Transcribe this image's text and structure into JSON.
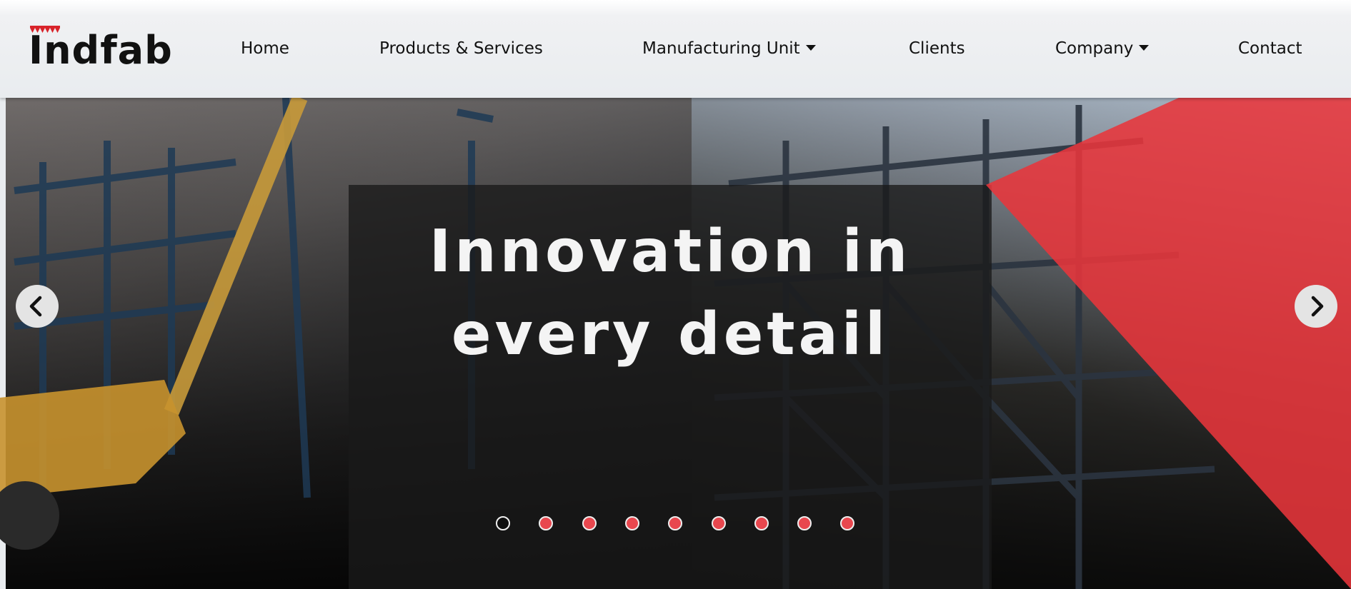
{
  "brand": {
    "logo_text": "Indfab",
    "accent_color": "#e8353b"
  },
  "nav": {
    "items": [
      {
        "label": "Home",
        "has_dropdown": false
      },
      {
        "label": "Products & Services",
        "has_dropdown": false
      },
      {
        "label": "Manufacturing Unit",
        "has_dropdown": true
      },
      {
        "label": "Clients",
        "has_dropdown": false
      },
      {
        "label": "Company",
        "has_dropdown": true
      },
      {
        "label": "Contact",
        "has_dropdown": false
      }
    ]
  },
  "hero": {
    "caption_line1": "Innovation in",
    "caption_line2": "every detail",
    "prev_icon": "chevron-left-icon",
    "next_icon": "chevron-right-icon",
    "slide_count": 9,
    "active_slide": 1
  }
}
